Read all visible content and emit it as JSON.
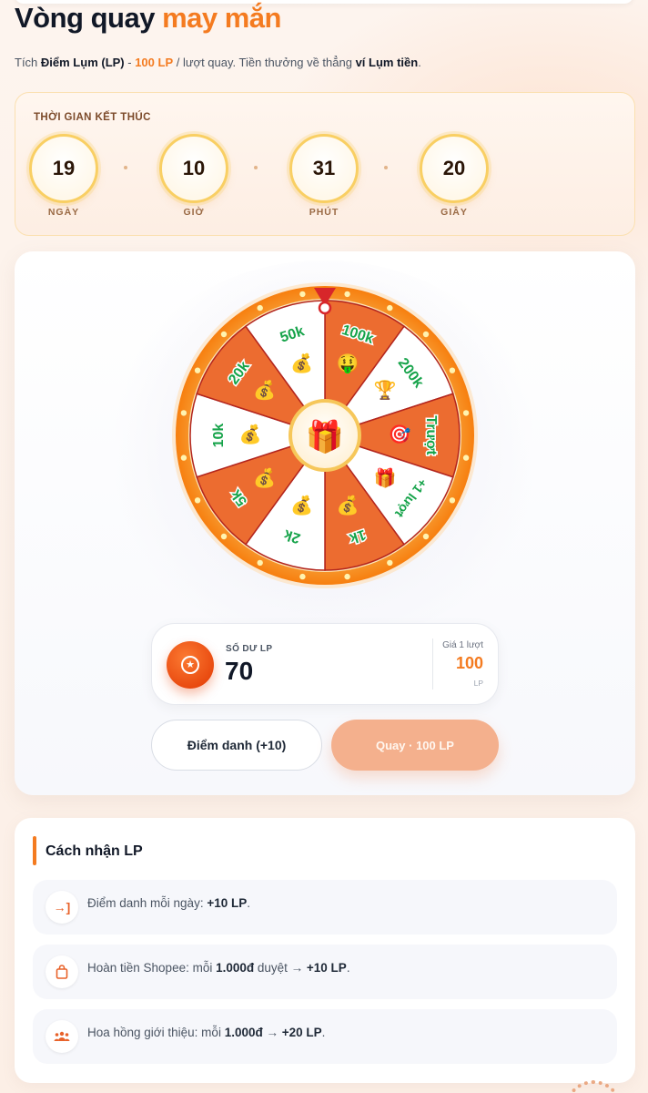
{
  "header": {
    "title_main": "Vòng quay",
    "title_accent": "may mắn",
    "subtitle": {
      "p1": "Tích ",
      "points_name": "Điểm Lụm (LP)",
      "p2": " - ",
      "cost": "100 LP",
      "p3": " / lượt quay. Tiền thưởng về thẳng ",
      "wallet": "ví Lụm tiền",
      "p4": "."
    }
  },
  "countdown": {
    "label": "THỜI GIAN KẾT THÚC",
    "units": [
      {
        "value": "19",
        "caption": "NGÀY"
      },
      {
        "value": "10",
        "caption": "GIỜ"
      },
      {
        "value": "31",
        "caption": "PHÚT"
      },
      {
        "value": "20",
        "caption": "GIÂY"
      }
    ]
  },
  "wheel": {
    "segments": [
      {
        "label": "100k",
        "emoji": "🤑",
        "style": "orange"
      },
      {
        "label": "200k",
        "emoji": "🏆",
        "style": "white"
      },
      {
        "label": "Trượt",
        "emoji": "🎯",
        "style": "orange"
      },
      {
        "label": "+1 lượt",
        "emoji": "🎁",
        "style": "white"
      },
      {
        "label": "1k",
        "emoji": "💰",
        "style": "orange"
      },
      {
        "label": "2k",
        "emoji": "💰",
        "style": "white"
      },
      {
        "label": "5k",
        "emoji": "💰",
        "style": "orange"
      },
      {
        "label": "10k",
        "emoji": "💰",
        "style": "white"
      },
      {
        "label": "20k",
        "emoji": "💰",
        "style": "orange"
      },
      {
        "label": "50k",
        "emoji": "💰",
        "style": "white"
      }
    ],
    "center_emoji": "🎁",
    "colors": {
      "orange": "#ec6c30",
      "white": "#ffffff",
      "rim": "#f7941d",
      "divider": "#b3261e",
      "label": "#16a34a"
    }
  },
  "balance": {
    "label": "SỐ DƯ LP",
    "value": "70",
    "icon": "star-coin-icon",
    "price_label": "Giá 1 lượt",
    "price_value": "100",
    "price_unit": "LP"
  },
  "actions": {
    "checkin_label": "Điểm danh (+10)",
    "spin_label": "Quay · 100 LP"
  },
  "howto": {
    "title": "Cách nhận LP",
    "items": [
      {
        "icon": "login-arrow-icon",
        "text": "Điểm danh mỗi ngày: ",
        "bold": "+10 LP",
        "tail": "."
      },
      {
        "icon": "shopping-bag-icon",
        "text": "Hoàn tiền Shopee: mỗi ",
        "bold": "1.000đ",
        "mid": " duyệt → ",
        "bold2": "+10 LP",
        "tail": "."
      },
      {
        "icon": "group-users-icon",
        "text": "Hoa hồng giới thiệu: mỗi ",
        "bold": "1.000đ",
        "mid": " → ",
        "bold2": "+20 LP",
        "tail": "."
      }
    ]
  }
}
